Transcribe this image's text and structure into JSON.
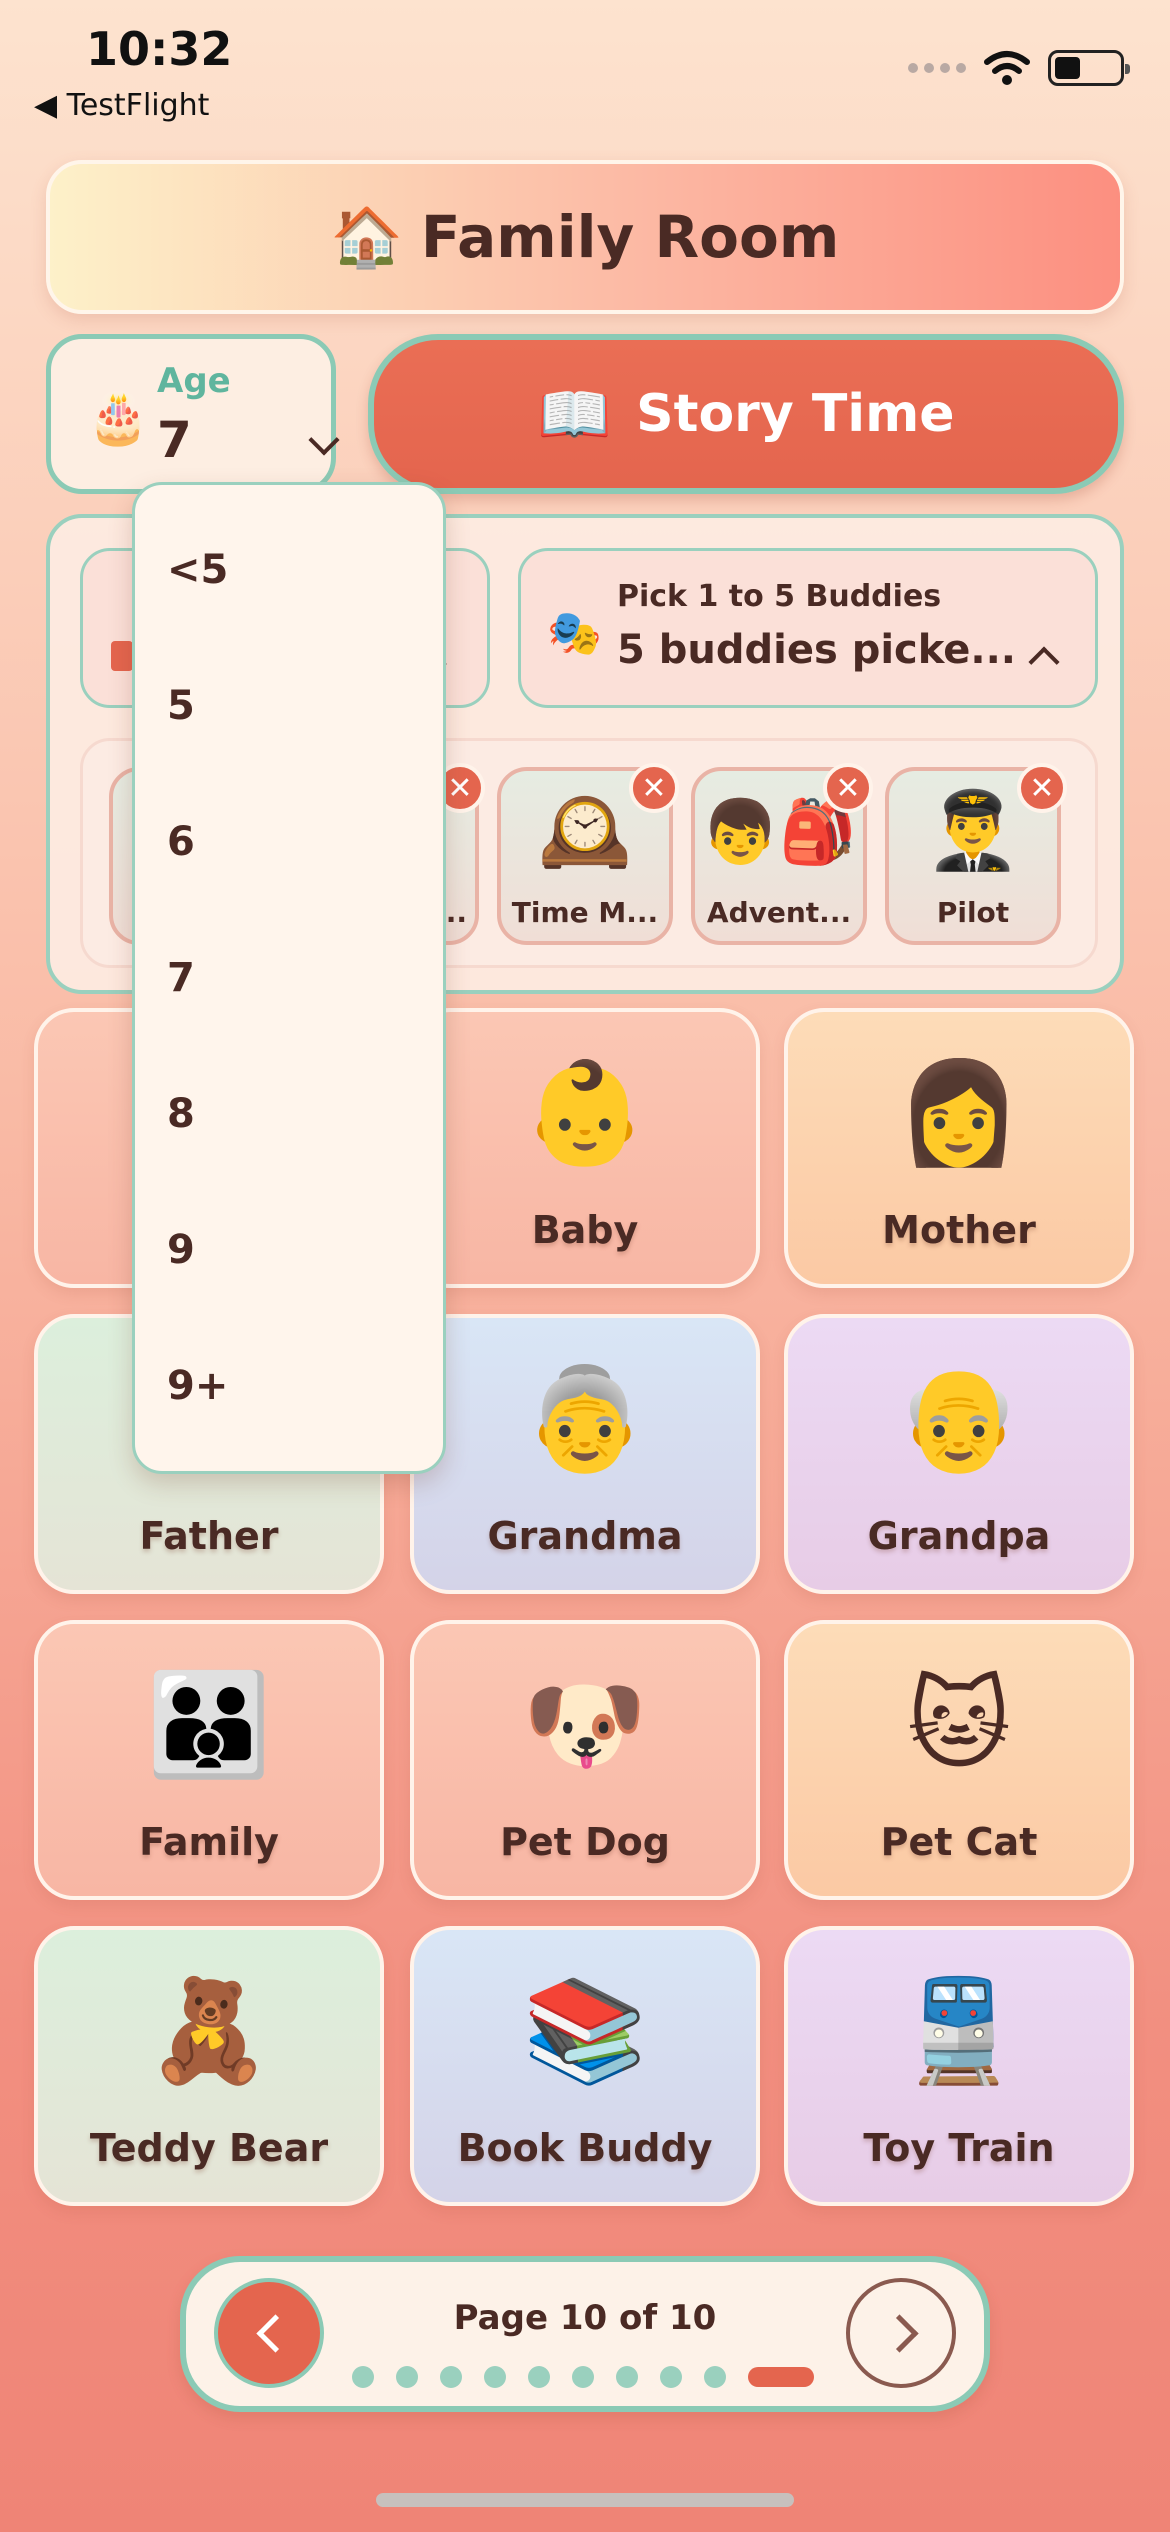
{
  "status_bar": {
    "time": "10:32",
    "back_app": "◀ TestFlight"
  },
  "header": {
    "icon": "🏠",
    "title": "Family Room"
  },
  "age": {
    "label": "Age",
    "value": "7",
    "icon": "🎂"
  },
  "story_button": {
    "icon": "📖",
    "label": "Story Time"
  },
  "buddy_picker": {
    "icon": "🎭",
    "hint": "Pick 1 to 5 Buddies",
    "value": "5 buddies picke..."
  },
  "selected_chips": [
    {
      "emoji": "",
      "name": "..."
    },
    {
      "emoji": "🕰️",
      "name": "Time M..."
    },
    {
      "emoji": "👦🎒",
      "name": "Advent..."
    },
    {
      "emoji": "👨‍✈️",
      "name": "Pilot"
    }
  ],
  "chip_close_symbol": "✕",
  "age_options": [
    "<5",
    "5",
    "6",
    "7",
    "8",
    "9",
    "9+"
  ],
  "cards": [
    {
      "emoji": "",
      "label": ""
    },
    {
      "emoji": "👶",
      "label": "Baby"
    },
    {
      "emoji": "👩",
      "label": "Mother"
    },
    {
      "emoji": "",
      "label": "Father"
    },
    {
      "emoji": "👵",
      "label": "Grandma"
    },
    {
      "emoji": "👴",
      "label": "Grandpa"
    },
    {
      "emoji": "👪",
      "label": "Family"
    },
    {
      "emoji": "🐶",
      "label": "Pet Dog"
    },
    {
      "emoji": "🐱",
      "label": "Pet Cat"
    },
    {
      "emoji": "🧸",
      "label": "Teddy Bear"
    },
    {
      "emoji": "📚",
      "label": "Book Buddy"
    },
    {
      "emoji": "🚆",
      "label": "Toy Train"
    }
  ],
  "pager": {
    "text": "Page 10 of 10",
    "current": 10,
    "total": 10
  }
}
